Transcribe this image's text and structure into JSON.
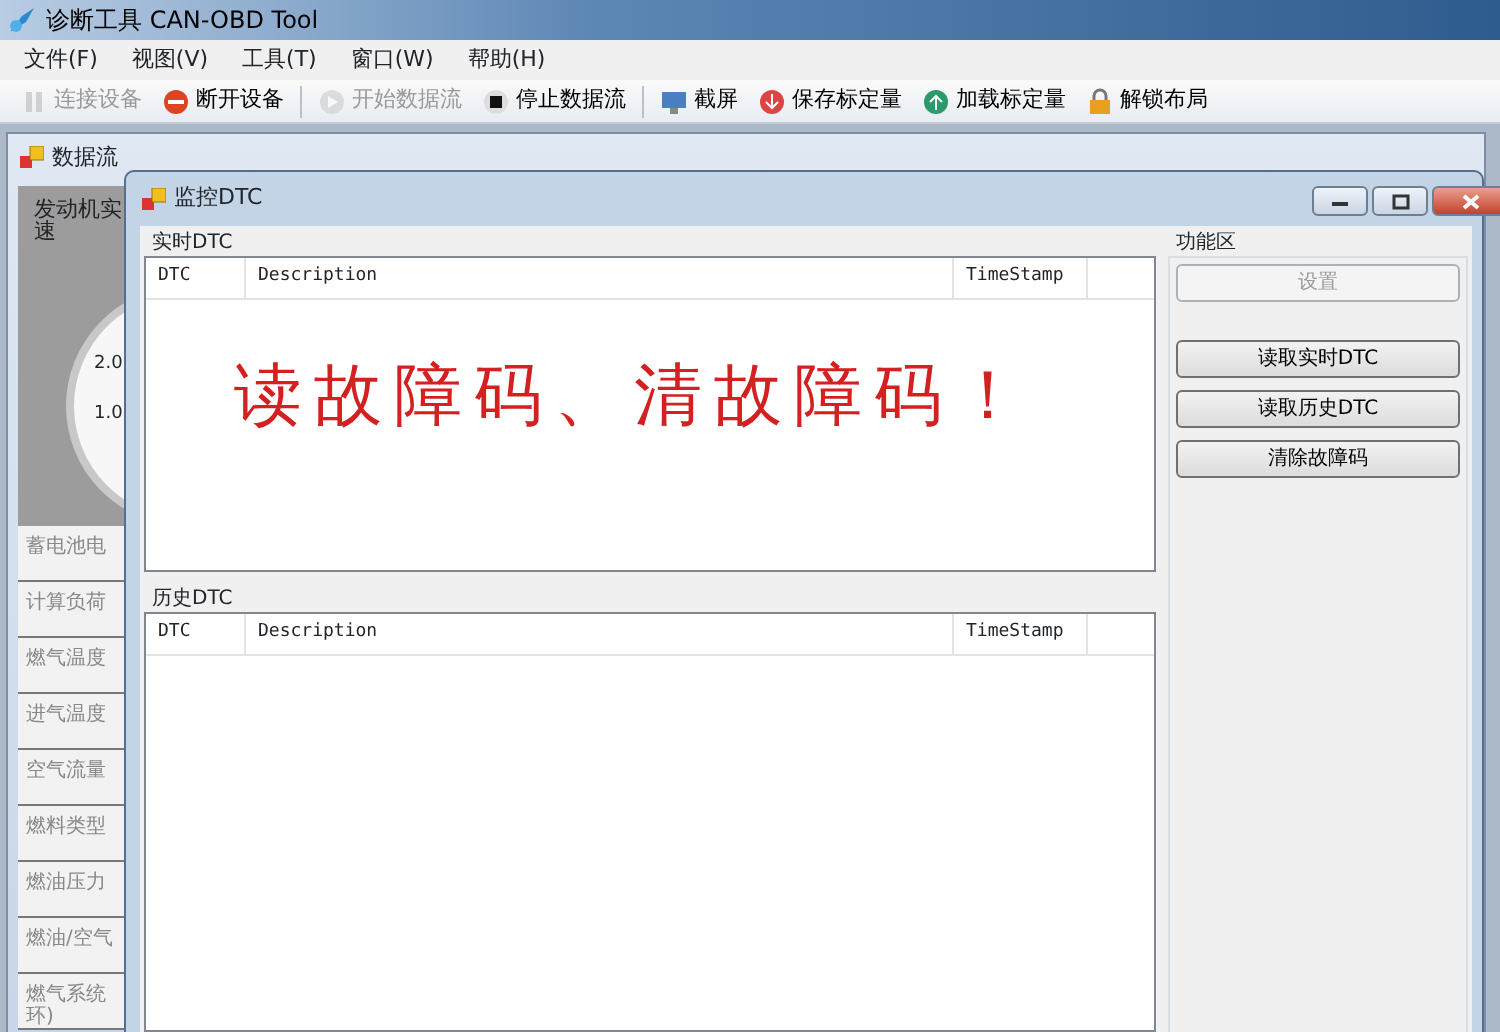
{
  "window": {
    "title": "诊断工具 CAN-OBD Tool"
  },
  "menu": [
    "文件(F)",
    "视图(V)",
    "工具(T)",
    "窗口(W)",
    "帮助(H)"
  ],
  "toolbar": [
    {
      "kind": "button",
      "label": "连接设备",
      "disabled": true
    },
    {
      "kind": "button",
      "label": "断开设备",
      "disabled": false
    },
    {
      "kind": "separator"
    },
    {
      "kind": "button",
      "label": "开始数据流",
      "disabled": true
    },
    {
      "kind": "button",
      "label": "停止数据流",
      "disabled": false
    },
    {
      "kind": "separator"
    },
    {
      "kind": "button",
      "label": "截屏",
      "disabled": false
    },
    {
      "kind": "button",
      "label": "保存标定量",
      "disabled": false
    },
    {
      "kind": "button",
      "label": "加载标定量",
      "disabled": false
    },
    {
      "kind": "button",
      "label": "解锁布局",
      "disabled": false
    }
  ],
  "data_window": {
    "title": "数据流",
    "gauge_title": [
      "发动机实",
      "速"
    ],
    "gauge_labels": [
      "2.0",
      "1.0"
    ],
    "items": [
      {
        "lines": [
          "蓄电池电"
        ]
      },
      {
        "lines": [
          "计算负荷"
        ]
      },
      {
        "lines": [
          "燃气温度"
        ]
      },
      {
        "lines": [
          "进气温度"
        ]
      },
      {
        "lines": [
          "空气流量"
        ]
      },
      {
        "lines": [
          "燃料类型"
        ]
      },
      {
        "lines": [
          "燃油压力"
        ]
      },
      {
        "lines": [
          "燃油/空气"
        ]
      },
      {
        "lines": [
          "燃气系统",
          "环)"
        ]
      }
    ]
  },
  "dtc_window": {
    "title": "监控DTC",
    "realtime": {
      "label": "实时DTC",
      "columns": [
        "DTC",
        "Description",
        "TimeStamp"
      ],
      "overlay_text": "读故障码、清故障码！"
    },
    "history": {
      "label": "历史DTC",
      "columns": [
        "DTC",
        "Description",
        "TimeStamp"
      ]
    },
    "function_area": {
      "label": "功能区",
      "buttons": [
        {
          "label": "设置",
          "disabled": true
        },
        {
          "label": "读取实时DTC",
          "disabled": false
        },
        {
          "label": "读取历史DTC",
          "disabled": false
        },
        {
          "label": "清除故障码",
          "disabled": false
        }
      ]
    }
  }
}
